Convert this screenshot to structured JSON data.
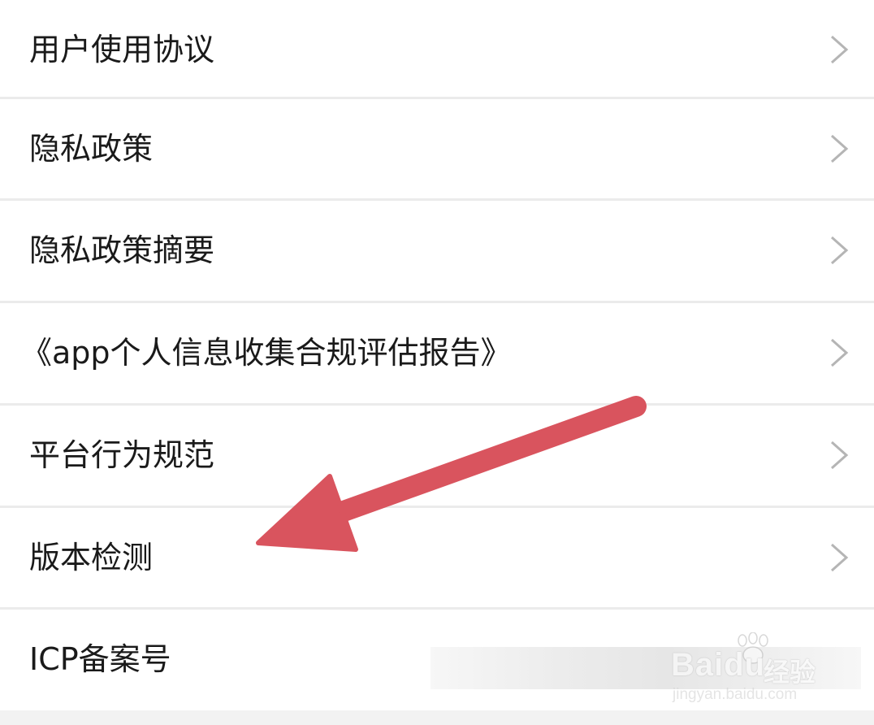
{
  "settings_list": {
    "items": [
      {
        "label": "用户使用协议",
        "icon": "chevron-right-icon"
      },
      {
        "label": "隐私政策",
        "icon": "chevron-right-icon"
      },
      {
        "label": "隐私政策摘要",
        "icon": "chevron-right-icon"
      },
      {
        "label": "《app个人信息收集合规评估报告》",
        "icon": "chevron-right-icon"
      },
      {
        "label": "平台行为规范",
        "icon": "chevron-right-icon"
      },
      {
        "label": "版本检测",
        "icon": "chevron-right-icon"
      },
      {
        "label": "ICP备案号"
      }
    ]
  },
  "annotation": {
    "arrow_color": "#d9545e",
    "points_to": "版本检测"
  },
  "watermark": {
    "brand": "Baidu",
    "brand_cn": "经验",
    "url": "jingyan.baidu.com"
  },
  "colors": {
    "text": "#1a1a1a",
    "chevron": "#b5b5b5",
    "divider": "#ebebeb",
    "background": "#f2f2f2"
  }
}
